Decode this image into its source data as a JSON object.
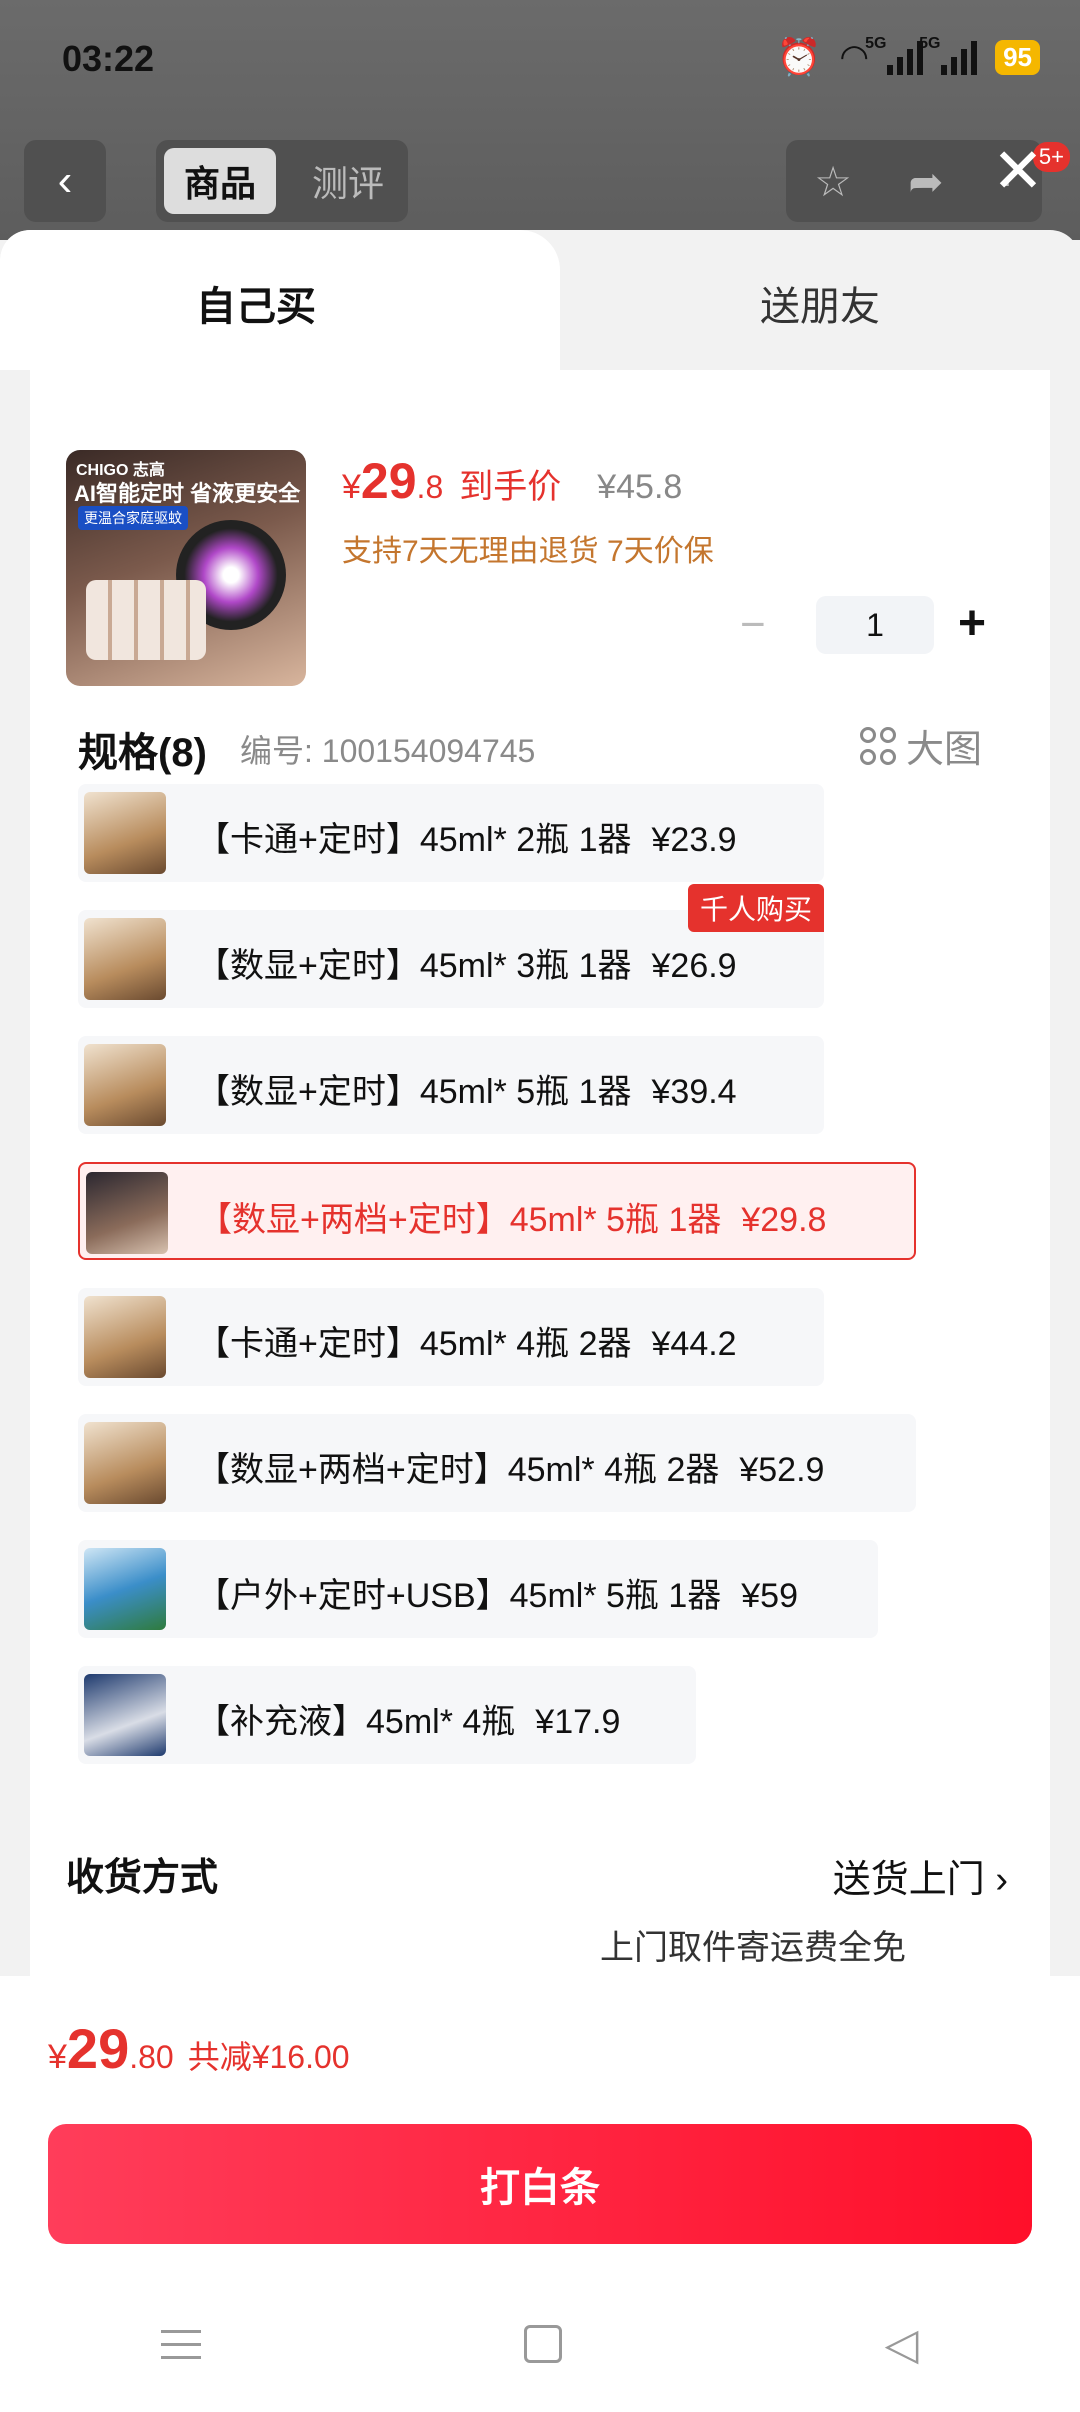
{
  "status_bar": {
    "time": "03:22",
    "network1": "5G",
    "network2": "5G",
    "battery": "95"
  },
  "top_nav": {
    "back_icon": "chevron-left-icon",
    "tab_goods": "商品",
    "tab_review": "测评",
    "favorite_icon": "star-icon",
    "share_icon": "share-icon",
    "more_badge": "5+",
    "close_icon": "close-icon"
  },
  "sheet_tabs": {
    "self": "自己买",
    "friend": "送朋友"
  },
  "product": {
    "image_brand": "CHIGO 志高",
    "image_headline": "AI智能定时 省液更安全",
    "image_sub": "更温合家庭驱蚊",
    "price_symbol": "¥",
    "price_int": "29",
    "price_dec": ".8",
    "price_label": "到手价",
    "original_price": "¥45.8",
    "policy": "支持7天无理由退货 7天价保",
    "quantity": "1"
  },
  "spec": {
    "title": "规格(8)",
    "code": "编号: 100154094745",
    "big_image_label": "大图",
    "hot_badge": "千人购买",
    "variants": [
      {
        "label": "【卡通+定时】45ml* 2瓶 1器",
        "price": "¥23.9"
      },
      {
        "label": "【数显+定时】45ml* 3瓶 1器",
        "price": "¥26.9"
      },
      {
        "label": "【数显+定时】45ml* 5瓶 1器",
        "price": "¥39.4"
      },
      {
        "label": "【数显+两档+定时】45ml* 5瓶 1器",
        "price": "¥29.8"
      },
      {
        "label": "【卡通+定时】45ml* 4瓶 2器",
        "price": "¥44.2"
      },
      {
        "label": "【数显+两档+定时】45ml* 4瓶 2器",
        "price": "¥52.9"
      },
      {
        "label": "【户外+定时+USB】45ml* 5瓶 1器",
        "price": "¥59"
      },
      {
        "label": "【补充液】45ml* 4瓶",
        "price": "¥17.9"
      }
    ]
  },
  "shipping": {
    "label": "收货方式",
    "value": "送货上门",
    "sub": "上门取件寄运费全免"
  },
  "footer": {
    "total_symbol": "¥",
    "total_int": "29",
    "total_dec": ".80",
    "discount": "共减¥16.00",
    "buy_button": "打白条"
  },
  "system_nav": {
    "menu_icon": "menu-icon",
    "home_icon": "home-icon",
    "back_icon": "back-triangle-icon"
  },
  "colors": {
    "accent": "#e5322d",
    "policy": "#c4762e",
    "button": "#ff1f3d"
  }
}
